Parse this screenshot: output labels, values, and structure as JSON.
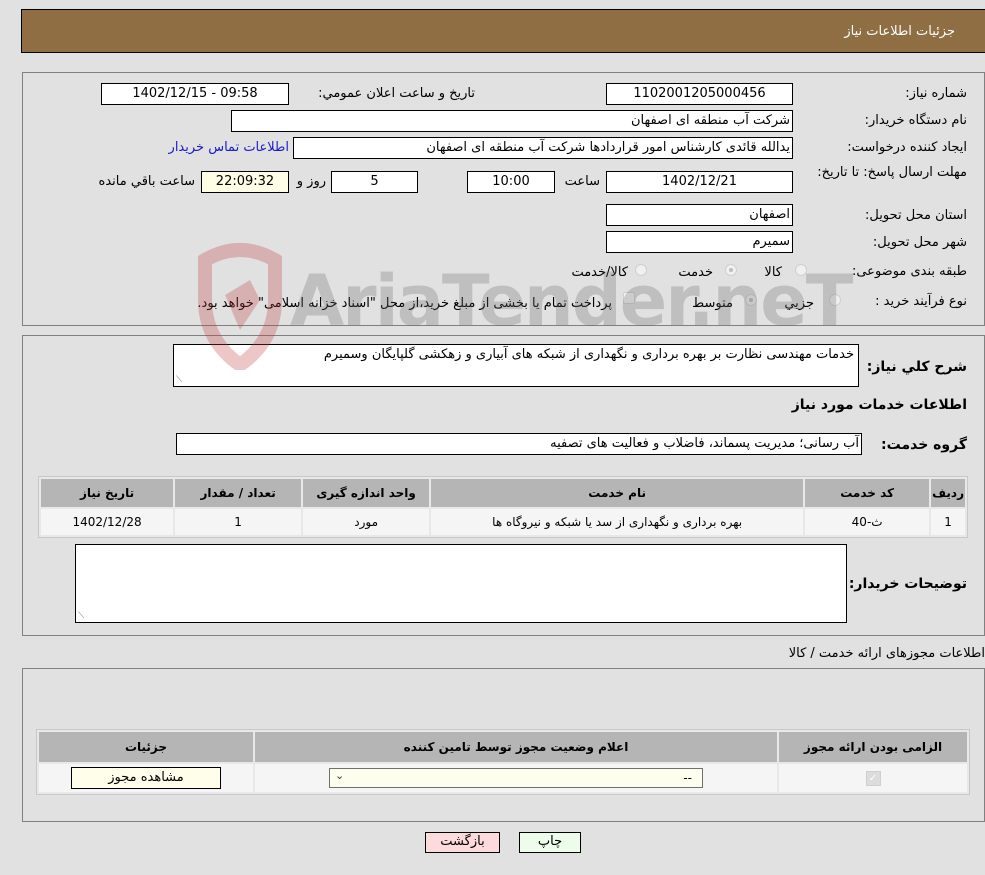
{
  "header": {
    "title": "جزئیات اطلاعات نیاز"
  },
  "form": {
    "need_number_label": "شماره نیاز:",
    "need_number": "1102001205000456",
    "announce_label": "تاریخ و ساعت اعلان عمومي:",
    "announce_value": "1402/12/15 - 09:58",
    "buyer_org_label": "نام دستگاه خریدار:",
    "buyer_org": "شرکت آب منطقه ای اصفهان",
    "requester_label": "ایجاد کننده درخواست:",
    "requester": "یدالله قائدی کارشناس امور قراردادها شرکت آب منطقه ای اصفهان",
    "contact_link": "اطلاعات تماس خریدار",
    "deadline_label": "مهلت ارسال پاسخ: تا تاریخ:",
    "deadline_date": "1402/12/21",
    "time_label": "ساعت",
    "deadline_time": "10:00",
    "days_value": "5",
    "days_label": "روز و",
    "remaining_time": "22:09:32",
    "remaining_label": "ساعت باقي مانده",
    "province_label": "استان محل تحویل:",
    "province": "اصفهان",
    "city_label": "شهر محل تحویل:",
    "city": "سمیرم",
    "category_label": "طبقه بندی موضوعی:",
    "category_options": [
      {
        "label": "کالا",
        "checked": false
      },
      {
        "label": "خدمت",
        "checked": true
      },
      {
        "label": "کالا/خدمت",
        "checked": false
      }
    ],
    "process_label": "نوع فرآیند خرید :",
    "process_options": [
      {
        "label": "جزيي",
        "checked": false
      },
      {
        "label": "متوسط",
        "checked": true
      }
    ],
    "treasury_note": "پرداخت تمام یا بخشی از مبلغ خرید،از محل \"اسناد خزانه اسلامی\" خواهد بود."
  },
  "details": {
    "description_label": "شرح کلي نیاز:",
    "description": "خدمات مهندسی نظارت بر بهره برداری و نگهداری از شبکه های آبیاری و زهکشی گلپایگان وسمیرم",
    "services_heading": "اطلاعات خدمات مورد نیاز",
    "service_group_label": "گروه خدمت:",
    "service_group": "آب رسانی؛ مدیریت پسماند، فاضلاب و فعالیت های تصفیه",
    "table": {
      "headers": [
        "ردیف",
        "کد خدمت",
        "نام خدمت",
        "واحد اندازه گیری",
        "تعداد / مقدار",
        "تاریخ نیاز"
      ],
      "rows": [
        [
          "1",
          "ث-40",
          "بهره برداری و نگهداری از سد یا شبکه و نیروگاه ها",
          "مورد",
          "1",
          "1402/12/28"
        ]
      ]
    },
    "buyer_notes_label": "توضیحات خریدار:",
    "buyer_notes": ""
  },
  "permits": {
    "title": "اطلاعات مجوزهای ارائه خدمت / کالا",
    "headers": [
      "الزامی بودن ارائه مجوز",
      "اعلام وضعیت مجوز توسط تامین کننده",
      "جزئیات"
    ],
    "row": {
      "required": true,
      "status_selected": "--",
      "details_button": "مشاهده مجوز"
    }
  },
  "actions": {
    "print": "چاپ",
    "back": "بازگشت"
  },
  "watermark": "AriaTender.neT"
}
